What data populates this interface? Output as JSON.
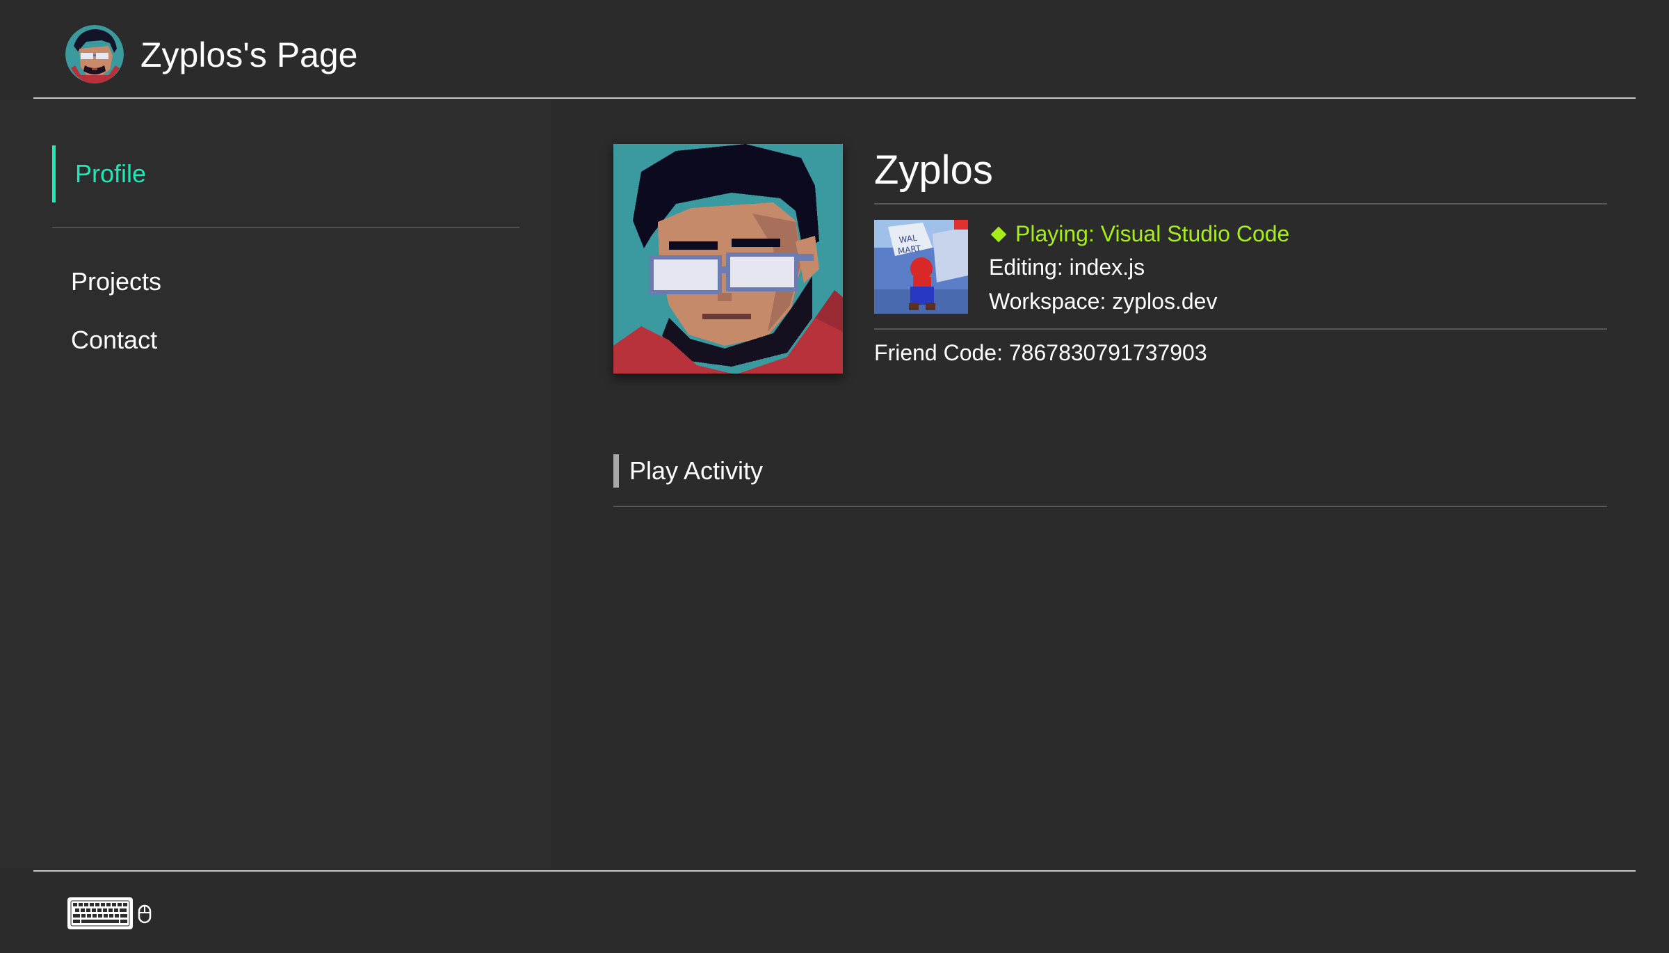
{
  "header": {
    "title": "Zyplos's Page",
    "avatar_icon": "pixel-art-avatar-icon"
  },
  "sidebar": {
    "items": [
      {
        "label": "Profile",
        "active": true
      },
      {
        "label": "Projects",
        "active": false
      },
      {
        "label": "Contact",
        "active": false
      }
    ]
  },
  "profile": {
    "name": "Zyplos",
    "status": "Playing: Visual Studio Code",
    "editing": "Editing: index.js",
    "workspace": "Workspace: zyplos.dev",
    "friend_code": "Friend Code: 7867830791737903"
  },
  "activity": {
    "title": "Play Activity"
  },
  "footer": {
    "icons": [
      "keyboard-icon",
      "mouse-icon"
    ]
  },
  "colors": {
    "background": "#2b2b2b",
    "accent": "#1de9b6",
    "status": "#a6ee1b",
    "divider": "#c8c8c8"
  }
}
